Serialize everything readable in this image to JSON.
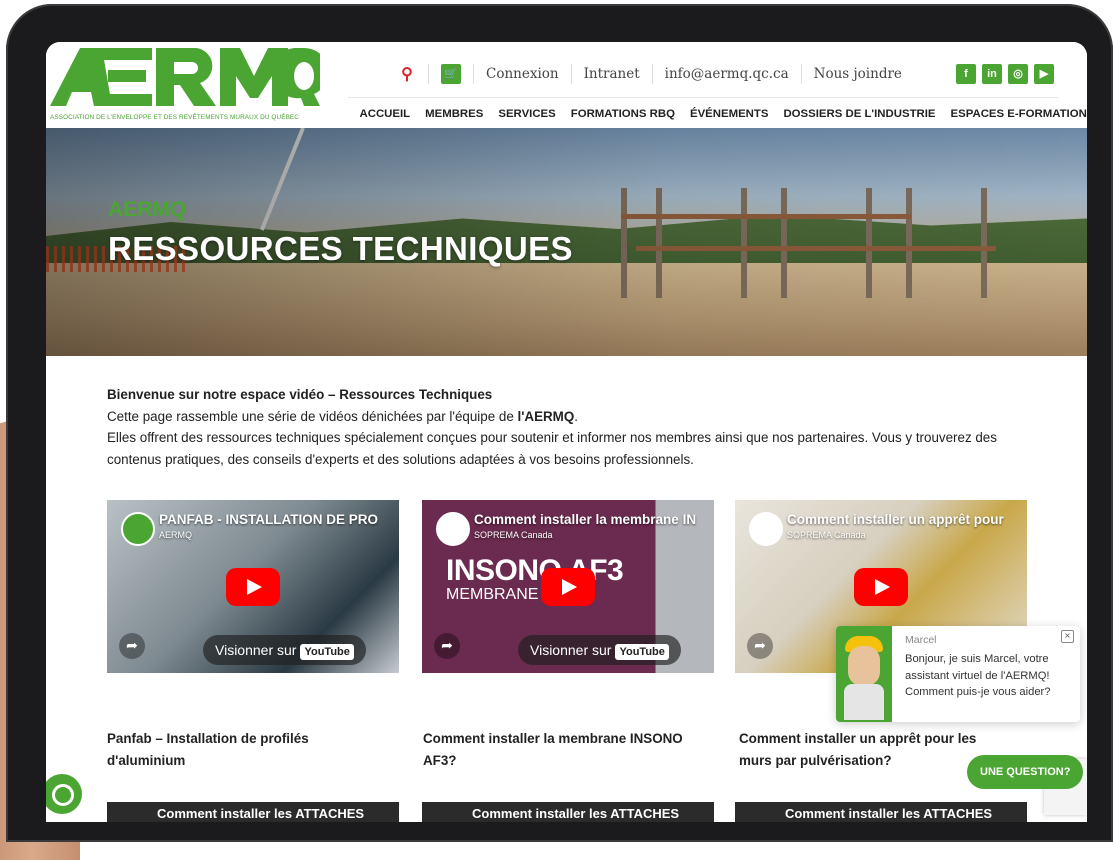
{
  "logo": {
    "wordmark": "AERMQ",
    "subtitle": "ASSOCIATION DE L'ENVELOPPE ET DES REVÊTEMENTS MURAUX DU QUÉBEC"
  },
  "topbar": {
    "search_icon": "search-icon",
    "cart_icon": "cart-icon",
    "connexion": "Connexion",
    "intranet": "Intranet",
    "email": "info@aermq.qc.ca",
    "contact": "Nous joindre",
    "social": [
      "f",
      "in",
      "◎",
      "▶"
    ]
  },
  "nav": {
    "items": [
      "ACCUEIL",
      "MEMBRES",
      "SERVICES",
      "FORMATIONS RBQ",
      "ÉVÉNEMENTS",
      "DOSSIERS DE L'INDUSTRIE",
      "ESPACES E-FORMATIONS"
    ],
    "active": "SERVICES"
  },
  "hero": {
    "kicker": "AERMQ",
    "title": "RESSOURCES TECHNIQUES"
  },
  "intro": {
    "lead": "Bienvenue sur notre espace vidéo – Ressources Techniques",
    "line2_pre": "Cette page rassemble une série de vidéos dénichées par l'équipe de ",
    "line2_bold": "l'AERMQ",
    "line2_post": ".",
    "line3": "Elles offrent des ressources techniques spécialement conçues pour soutenir et informer nos membres ainsi que nos partenaires. Vous y trouverez des contenus pratiques, des conseils d'experts et des solutions adaptées à vos besoins professionnels."
  },
  "videos": [
    {
      "title": "PANFAB - INSTALLATION DE PRO",
      "channel": "AERMQ",
      "watch_label": "Visionner sur",
      "yt": "YouTube",
      "caption": "Panfab – Installation de profilés d'aluminium"
    },
    {
      "title": "Comment installer la membrane IN",
      "channel": "SOPREMA Canada",
      "watch_label": "Visionner sur",
      "yt": "YouTube",
      "overlay_big": "INSONO AF3",
      "overlay_small": "MEMBRANE",
      "caption": "Comment installer la membrane INSONO AF3?"
    },
    {
      "title": "Comment installer un apprêt pour",
      "channel": "SOPREMA Canada",
      "caption": "Comment installer un apprêt pour les murs par pulvérisation?"
    }
  ],
  "next_videos": [
    "Comment installer les ATTACHES",
    "Comment installer les ATTACHES",
    "Comment installer les ATTACHES"
  ],
  "chat": {
    "name": "Marcel",
    "message": "Bonjour, je suis Marcel, votre assistant virtuel de l'AERMQ! Comment puis-je vous aider?",
    "close": "×"
  },
  "ask_button": "UNE QUESTION?",
  "colors": {
    "brand_green": "#4aa532",
    "youtube_red": "#ff0000"
  }
}
